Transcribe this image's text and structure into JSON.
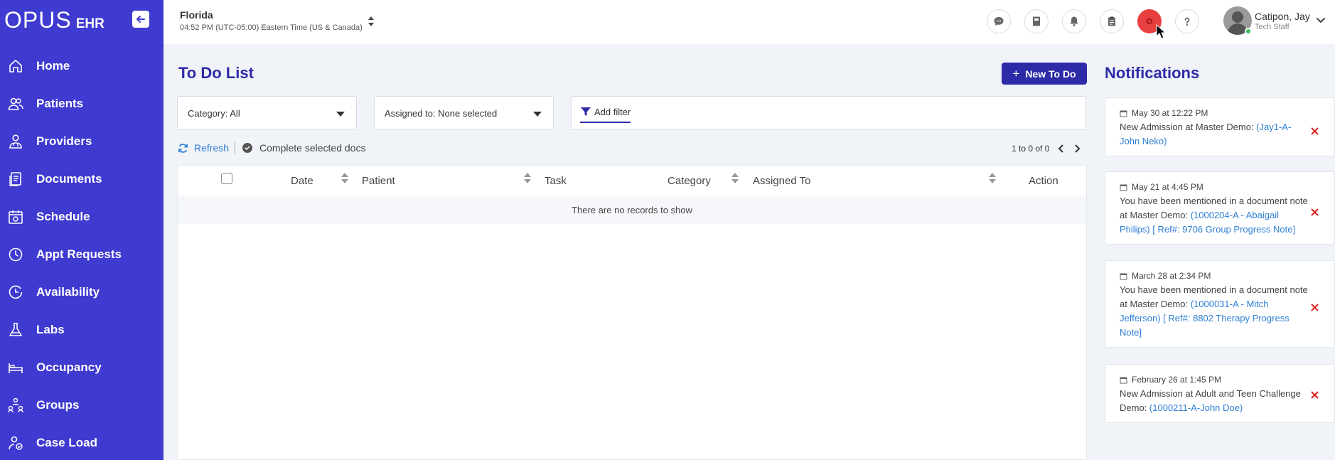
{
  "logo": {
    "main": "OPUS",
    "sub": "EHR"
  },
  "sidebar": {
    "items": [
      {
        "label": "Home",
        "icon": "home-icon"
      },
      {
        "label": "Patients",
        "icon": "users-icon"
      },
      {
        "label": "Providers",
        "icon": "doctor-icon"
      },
      {
        "label": "Documents",
        "icon": "documents-icon"
      },
      {
        "label": "Schedule",
        "icon": "calendar-icon"
      },
      {
        "label": "Appt Requests",
        "icon": "clock-icon"
      },
      {
        "label": "Availability",
        "icon": "availability-icon"
      },
      {
        "label": "Labs",
        "icon": "flask-icon"
      },
      {
        "label": "Occupancy",
        "icon": "bed-icon"
      },
      {
        "label": "Groups",
        "icon": "groups-icon"
      },
      {
        "label": "Case Load",
        "icon": "caseload-icon"
      }
    ]
  },
  "header": {
    "location": "Florida",
    "time": "04:52 PM (UTC-05:00) Eastern Time (US & Canada)",
    "user_name": "Catipon, Jay",
    "user_role": "Tech Staff"
  },
  "todo": {
    "title": "To Do List",
    "new_button": "New To Do",
    "category_select": "Category: All",
    "assigned_select": "Assigned to: None selected",
    "add_filter": "Add filter",
    "refresh": "Refresh",
    "complete_selected": "Complete selected docs",
    "pager": "1 to 0 of 0",
    "columns": [
      "Date",
      "Patient",
      "Task",
      "Category",
      "Assigned To",
      "Action"
    ],
    "empty_text": "There are no records to show"
  },
  "notifications": {
    "title": "Notifications",
    "items": [
      {
        "date": "May 30 at 12:22 PM",
        "text": "New Admission at Master Demo: ",
        "link": "(Jay1-A-John Neko)"
      },
      {
        "date": "May 21 at 4:45 PM",
        "text": "You have been mentioned in a document note at Master Demo: ",
        "link": "(1000204-A - Abaigail Philips) [ Ref#: 9706 Group Progress Note]"
      },
      {
        "date": "March 28 at 2:34 PM",
        "text": "You have been mentioned in a document note at Master Demo: ",
        "link": "(1000031-A - Mitch Jefferson) [ Ref#: 8802 Therapy Progress Note]"
      },
      {
        "date": "February 26 at 1:45 PM",
        "text": "New Admission at Adult and Teen Challenge Demo: ",
        "link": "(1000211-A-John Doe)"
      }
    ]
  },
  "colors": {
    "sidebar": "#3f3ad0",
    "accent": "#2e2ba8",
    "link": "#2f7fd6",
    "close": "#e02020"
  }
}
